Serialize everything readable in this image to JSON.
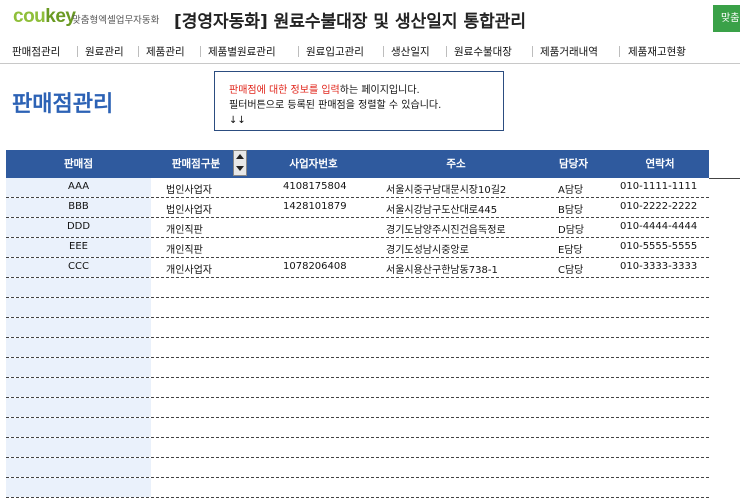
{
  "header": {
    "logo_main": "cou",
    "logo_key": "key",
    "tagline": "맞춤형엑셀업무자동화",
    "title": "[경영자동화] 원료수불대장 및 생산일지 통합관리",
    "green_button": "맞춤"
  },
  "nav": {
    "items": [
      {
        "label": "판매점관리"
      },
      {
        "label": "원료관리"
      },
      {
        "label": "제품관리"
      },
      {
        "label": "제품별원료관리"
      },
      {
        "label": "원료입고관리"
      },
      {
        "label": "생산일지"
      },
      {
        "label": "원료수불대장"
      },
      {
        "label": "제품거래내역"
      },
      {
        "label": "제품재고현황"
      }
    ]
  },
  "page": {
    "title": "판매점관리"
  },
  "info": {
    "line1_red": "판매점에 대한 정보를 입력",
    "line1_rest": "하는 페이지입니다.",
    "line2": "필터버튼으로 등록된 판매점을 정렬할 수 있습니다.",
    "line3": "↓↓"
  },
  "table": {
    "headers": [
      "판매점",
      "판매점구분",
      "사업자번호",
      "주소",
      "담당자",
      "연락처"
    ],
    "rows": [
      {
        "store": "AAA",
        "type": "법인사업자",
        "biz_no": "4108175804",
        "address": "서울시중구남대문시장10길2",
        "manager": "A담당",
        "phone": "010-1111-1111"
      },
      {
        "store": "BBB",
        "type": "법인사업자",
        "biz_no": "1428101879",
        "address": "서울시강남구도산대로445",
        "manager": "B담당",
        "phone": "010-2222-2222"
      },
      {
        "store": "DDD",
        "type": "개인직판",
        "biz_no": "",
        "address": "경기도남양주시진건읍독정로",
        "manager": "D담당",
        "phone": "010-4444-4444"
      },
      {
        "store": "EEE",
        "type": "개인직판",
        "biz_no": "",
        "address": "경기도성남시중앙로",
        "manager": "E담당",
        "phone": "010-5555-5555"
      },
      {
        "store": "CCC",
        "type": "개인사업자",
        "biz_no": "1078206408",
        "address": "서울시용산구한남동738-1",
        "manager": "C담당",
        "phone": "010-3333-3333"
      }
    ],
    "empty_rows": 11
  },
  "colors": {
    "header_bg": "#2f5a9e",
    "title_blue": "#2c62b5",
    "accent_red": "#e0241a",
    "logo_green": "#8fbf3a",
    "button_green": "#3aa148"
  }
}
